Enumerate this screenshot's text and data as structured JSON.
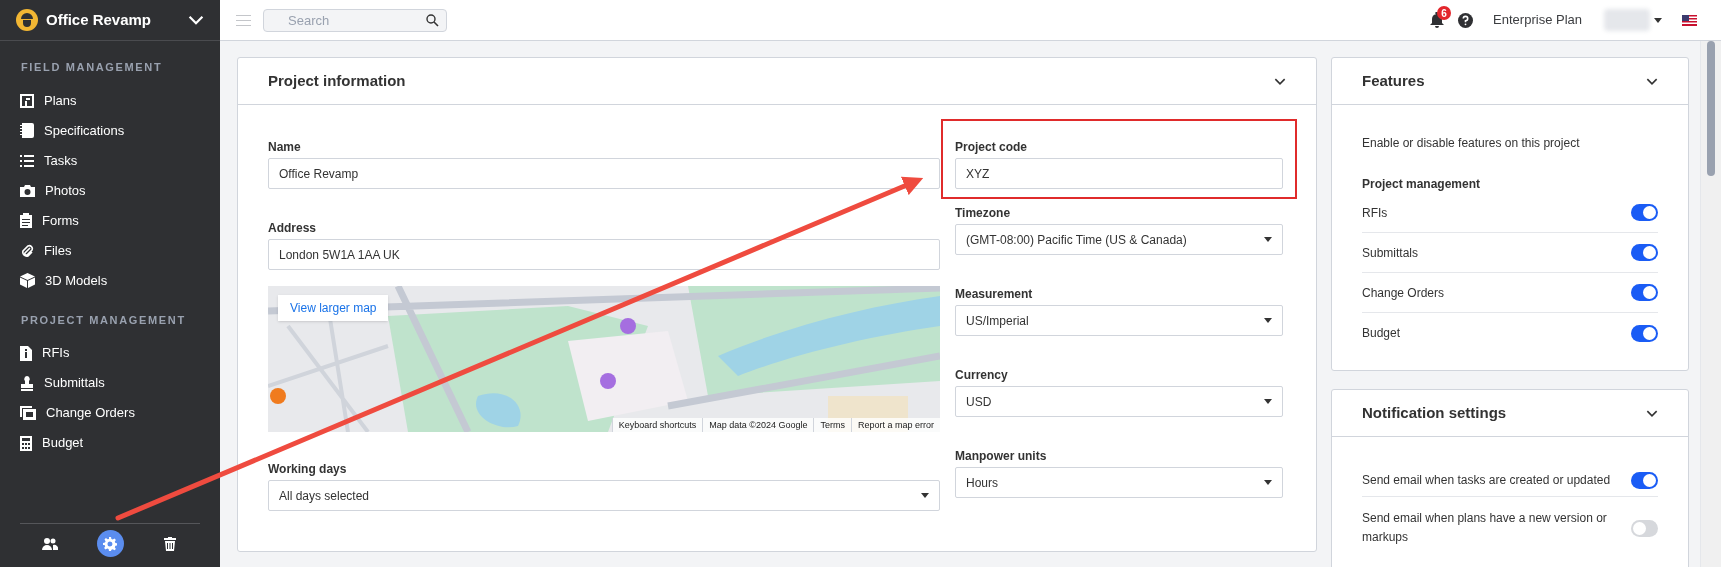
{
  "sidebar": {
    "project": "Office Revamp",
    "sections": [
      {
        "heading": "FIELD MANAGEMENT",
        "items": [
          {
            "label": "Plans",
            "kind": "plans"
          },
          {
            "label": "Specifications",
            "kind": "specs"
          },
          {
            "label": "Tasks",
            "kind": "tasks"
          },
          {
            "label": "Photos",
            "kind": "photos"
          },
          {
            "label": "Forms",
            "kind": "forms"
          },
          {
            "label": "Files",
            "kind": "files"
          },
          {
            "label": "3D Models",
            "kind": "models"
          }
        ]
      },
      {
        "heading": "PROJECT MANAGEMENT",
        "items": [
          {
            "label": "RFIs",
            "kind": "rfis"
          },
          {
            "label": "Submittals",
            "kind": "submittals"
          },
          {
            "label": "Change Orders",
            "kind": "orders"
          },
          {
            "label": "Budget",
            "kind": "budget"
          }
        ]
      }
    ],
    "footer": [
      {
        "kind": "people",
        "selected": false
      },
      {
        "kind": "settings",
        "selected": true
      },
      {
        "kind": "trash",
        "selected": false
      }
    ]
  },
  "topbar": {
    "search": {
      "placeholder": "Search"
    },
    "notifications": "6",
    "plan": "Enterprise Plan"
  },
  "project_info": {
    "title": "Project information",
    "left": [
      {
        "label": "Name",
        "value": "Office Revamp",
        "kind": "text",
        "highlighted": false
      },
      {
        "label": "Address",
        "value": "London 5W1A 1AA UK",
        "kind": "text",
        "highlighted": false
      },
      {
        "kind": "map",
        "button": "View larger map",
        "attribution": [
          "Keyboard shortcuts",
          "Map data ©2024 Google",
          "Terms",
          "Report a map error"
        ]
      },
      {
        "label": "Working days",
        "value": "All days selected",
        "kind": "select",
        "highlighted": false
      }
    ],
    "right": [
      {
        "label": "Project code",
        "value": "XYZ",
        "kind": "text",
        "highlighted": true
      },
      {
        "label": "Timezone",
        "value": "(GMT-08:00) Pacific Time (US & Canada)",
        "kind": "select",
        "highlighted": false
      },
      {
        "label": "Measurement",
        "value": "US/Imperial",
        "kind": "select",
        "highlighted": false
      },
      {
        "label": "Currency",
        "value": "USD",
        "kind": "select",
        "highlighted": false
      },
      {
        "label": "Manpower units",
        "value": "Hours",
        "kind": "select",
        "highlighted": false
      }
    ]
  },
  "features": {
    "title": "Features",
    "description": "Enable or disable features on this project",
    "group": "Project management",
    "toggles": [
      {
        "label": "RFIs",
        "on": true
      },
      {
        "label": "Submittals",
        "on": true
      },
      {
        "label": "Change Orders",
        "on": true
      },
      {
        "label": "Budget",
        "on": true
      }
    ]
  },
  "notifications": {
    "title": "Notification settings",
    "toggles": [
      {
        "label": "Send email when tasks are created or updated",
        "on": true
      },
      {
        "label": "Send email when plans have a new version or markups",
        "on": false
      }
    ]
  }
}
